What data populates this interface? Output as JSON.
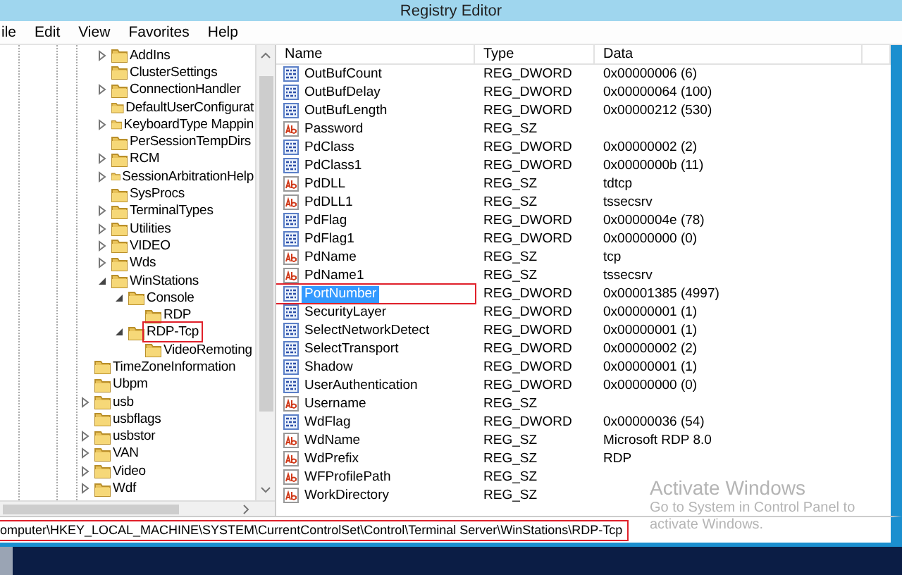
{
  "window": {
    "title": "Registry Editor"
  },
  "menu": [
    "ile",
    "Edit",
    "View",
    "Favorites",
    "Help"
  ],
  "tree": {
    "branch_children": [
      {
        "label": "AddIns",
        "expanded": false,
        "boxed": false
      },
      {
        "label": "ClusterSettings",
        "boxed": false
      },
      {
        "label": "ConnectionHandler",
        "expanded": false,
        "boxed": false
      },
      {
        "label": "DefaultUserConfigurat",
        "boxed": false
      },
      {
        "label": "KeyboardType Mappin",
        "expanded": false,
        "boxed": false
      },
      {
        "label": "PerSessionTempDirs",
        "boxed": false
      },
      {
        "label": "RCM",
        "expanded": false,
        "boxed": false
      },
      {
        "label": "SessionArbitrationHelp",
        "expanded": false,
        "boxed": false
      },
      {
        "label": "SysProcs",
        "boxed": false
      },
      {
        "label": "TerminalTypes",
        "expanded": false,
        "boxed": false
      },
      {
        "label": "Utilities",
        "expanded": false,
        "boxed": false
      },
      {
        "label": "VIDEO",
        "expanded": false,
        "boxed": false
      },
      {
        "label": "Wds",
        "expanded": false,
        "boxed": false
      },
      {
        "label": "WinStations",
        "expanded": true,
        "boxed": false,
        "children": [
          {
            "label": "Console",
            "expanded": true,
            "boxed": false,
            "children": [
              {
                "label": "RDP",
                "boxed": false
              }
            ]
          },
          {
            "label": "RDP-Tcp",
            "expanded": true,
            "boxed": true,
            "children": [
              {
                "label": "VideoRemoting",
                "boxed": false
              }
            ]
          }
        ]
      }
    ],
    "items": [
      {
        "label": "TimeZoneInformation",
        "boxed": false
      },
      {
        "label": "Ubpm",
        "boxed": false
      },
      {
        "label": "usb",
        "expanded": false,
        "boxed": false
      },
      {
        "label": "usbflags",
        "boxed": false
      },
      {
        "label": "usbstor",
        "expanded": false,
        "boxed": false
      },
      {
        "label": "VAN",
        "expanded": false,
        "boxed": false
      },
      {
        "label": "Video",
        "expanded": false,
        "boxed": false
      },
      {
        "label": "Wdf",
        "expanded": false,
        "boxed": false
      }
    ]
  },
  "values": {
    "columns": [
      "Name",
      "Type",
      "Data"
    ],
    "rows": [
      {
        "kind": "dword",
        "name": "OutBufCount",
        "type": "REG_DWORD",
        "data": "0x00000006 (6)",
        "selected": false,
        "boxed": false
      },
      {
        "kind": "dword",
        "name": "OutBufDelay",
        "type": "REG_DWORD",
        "data": "0x00000064 (100)",
        "selected": false,
        "boxed": false
      },
      {
        "kind": "dword",
        "name": "OutBufLength",
        "type": "REG_DWORD",
        "data": "0x00000212 (530)",
        "selected": false,
        "boxed": false
      },
      {
        "kind": "sz",
        "name": "Password",
        "type": "REG_SZ",
        "data": "",
        "selected": false,
        "boxed": false
      },
      {
        "kind": "dword",
        "name": "PdClass",
        "type": "REG_DWORD",
        "data": "0x00000002 (2)",
        "selected": false,
        "boxed": false
      },
      {
        "kind": "dword",
        "name": "PdClass1",
        "type": "REG_DWORD",
        "data": "0x0000000b (11)",
        "selected": false,
        "boxed": false
      },
      {
        "kind": "sz",
        "name": "PdDLL",
        "type": "REG_SZ",
        "data": "tdtcp",
        "selected": false,
        "boxed": false
      },
      {
        "kind": "sz",
        "name": "PdDLL1",
        "type": "REG_SZ",
        "data": "tssecsrv",
        "selected": false,
        "boxed": false
      },
      {
        "kind": "dword",
        "name": "PdFlag",
        "type": "REG_DWORD",
        "data": "0x0000004e (78)",
        "selected": false,
        "boxed": false
      },
      {
        "kind": "dword",
        "name": "PdFlag1",
        "type": "REG_DWORD",
        "data": "0x00000000 (0)",
        "selected": false,
        "boxed": false
      },
      {
        "kind": "sz",
        "name": "PdName",
        "type": "REG_SZ",
        "data": "tcp",
        "selected": false,
        "boxed": false
      },
      {
        "kind": "sz",
        "name": "PdName1",
        "type": "REG_SZ",
        "data": "tssecsrv",
        "selected": false,
        "boxed": false
      },
      {
        "kind": "dword",
        "name": "PortNumber",
        "type": "REG_DWORD",
        "data": "0x00001385 (4997)",
        "selected": true,
        "boxed": true
      },
      {
        "kind": "dword",
        "name": "SecurityLayer",
        "type": "REG_DWORD",
        "data": "0x00000001 (1)",
        "selected": false,
        "boxed": false
      },
      {
        "kind": "dword",
        "name": "SelectNetworkDetect",
        "type": "REG_DWORD",
        "data": "0x00000001 (1)",
        "selected": false,
        "boxed": false
      },
      {
        "kind": "dword",
        "name": "SelectTransport",
        "type": "REG_DWORD",
        "data": "0x00000002 (2)",
        "selected": false,
        "boxed": false
      },
      {
        "kind": "dword",
        "name": "Shadow",
        "type": "REG_DWORD",
        "data": "0x00000001 (1)",
        "selected": false,
        "boxed": false
      },
      {
        "kind": "dword",
        "name": "UserAuthentication",
        "type": "REG_DWORD",
        "data": "0x00000000 (0)",
        "selected": false,
        "boxed": false
      },
      {
        "kind": "sz",
        "name": "Username",
        "type": "REG_SZ",
        "data": "",
        "selected": false,
        "boxed": false
      },
      {
        "kind": "dword",
        "name": "WdFlag",
        "type": "REG_DWORD",
        "data": "0x00000036 (54)",
        "selected": false,
        "boxed": false
      },
      {
        "kind": "sz",
        "name": "WdName",
        "type": "REG_SZ",
        "data": "Microsoft RDP 8.0",
        "selected": false,
        "boxed": false
      },
      {
        "kind": "sz",
        "name": "WdPrefix",
        "type": "REG_SZ",
        "data": "RDP",
        "selected": false,
        "boxed": false
      },
      {
        "kind": "sz",
        "name": "WFProfilePath",
        "type": "REG_SZ",
        "data": "",
        "selected": false,
        "boxed": false
      },
      {
        "kind": "sz",
        "name": "WorkDirectory",
        "type": "REG_SZ",
        "data": "",
        "selected": false,
        "boxed": false
      }
    ]
  },
  "status_bar": {
    "path": "omputer\\HKEY_LOCAL_MACHINE\\SYSTEM\\CurrentControlSet\\Control\\Terminal Server\\WinStations\\RDP-Tcp",
    "boxed": true
  },
  "activation_notice": {
    "title": "Activate Windows",
    "lines": [
      "Go to System in Control Panel to",
      "activate Windows."
    ]
  }
}
